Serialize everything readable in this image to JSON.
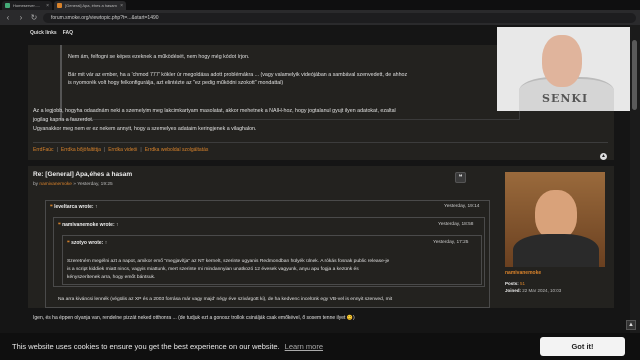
{
  "browser": {
    "tabs": [
      {
        "label": "Homeserver....."
      },
      {
        "label": "[General] Apa, éhes a hasam"
      }
    ],
    "url": "forum.smoke.org/viewtopic.php?t=...&start=1490"
  },
  "header": {
    "quick_links": "Quick links",
    "faq": "FAQ"
  },
  "post1": {
    "quote_lines": [
      "Nem ám, felfogni se képes ezeknek a működését, nem hogy még kódot írjon.",
      "Bár mit vár az ember, ha a 'chmod 777' kökler úr megoldása adott problémákra ... (vagy valamelyik videójában a sambával szenvedett, de ahhoz",
      "is nyomorék volt hogy felkonfigurálja, azt elintézte az \"ez pedig működni szokott\" mondattal)"
    ],
    "body_lines": [
      "Az a legjobb, hogyha odaadnám neki a szemelyim meg lakcimkartyam masolatat, akkor mehetnek a NAIH-hoz, hogy jogtalanul gyujt ilyen adatokat, ezaltal",
      "jogilag kapna a faszerdot.",
      "Ugyanakkor meg nem er ez nekem annyit, hogy a szemelyes adataim keringjenek a vilaghalon."
    ],
    "signature": [
      "ErrdFaúc",
      "Errdka bőjöfaltittja",
      "Errdka videói",
      "Errdka weboldal szolgáltatás"
    ]
  },
  "post2": {
    "title": "Re: [General] Apa,éhes a hasam",
    "by_prefix": "by",
    "author": "namivanemoke",
    "date": "» Yesterday, 19:25",
    "q1": {
      "author": "leveltarca",
      "wrote": "wrote: ↑",
      "date": "Yesterday, 19:14"
    },
    "q2": {
      "author": "namivanemoke",
      "wrote": "wrote: ↑",
      "date": "Yesterday, 18:58"
    },
    "q3": {
      "author": "szotyo",
      "wrote": "wrote: ↑",
      "date": "Yesterday, 17:25",
      "lines": [
        "Szeretném megélni azt a napot, amikor emő \"megjavítja\" az NT kernelt, szerinte ugyanis Redmondban hülyék ülnek. A rókás fosnak public release-je",
        "is a script kiddiek miatt nincs, vagyis miattunk, mert szerinte mi mindannyian unatkozó 12 évesek vagyunk, anyu apu fogja a kezünk és",
        "kényszerítenek arra, hogy emőt bántsuk."
      ]
    },
    "q2_tail": "Na arra kiváncsi lennék (végülis az XP és a 2003 forrása már vagy majd' négy éve szivárgott ki), de ha kedvenc incelünk egy VB-vel is ennyit szenved, mit",
    "tail": "Igen, és ha éppen olyanja van, rendelne pizzát neked otthonra ... (de tudjuk ezt a gonosz trollok csinálják csak emőkével, ő sosem tenne ilyet 😊)",
    "profile": {
      "name": "namivanemoke",
      "posts_label": "Posts:",
      "posts": "51",
      "joined_label": "Joined:",
      "joined": "22 Mar 2024, 10:03"
    }
  },
  "webcam": {
    "shirt_text": "SENKI"
  },
  "cookie": {
    "message": "This website uses cookies to ensure you get the best experience on our website.",
    "learn_more": "Learn more",
    "button": "Got it!"
  }
}
